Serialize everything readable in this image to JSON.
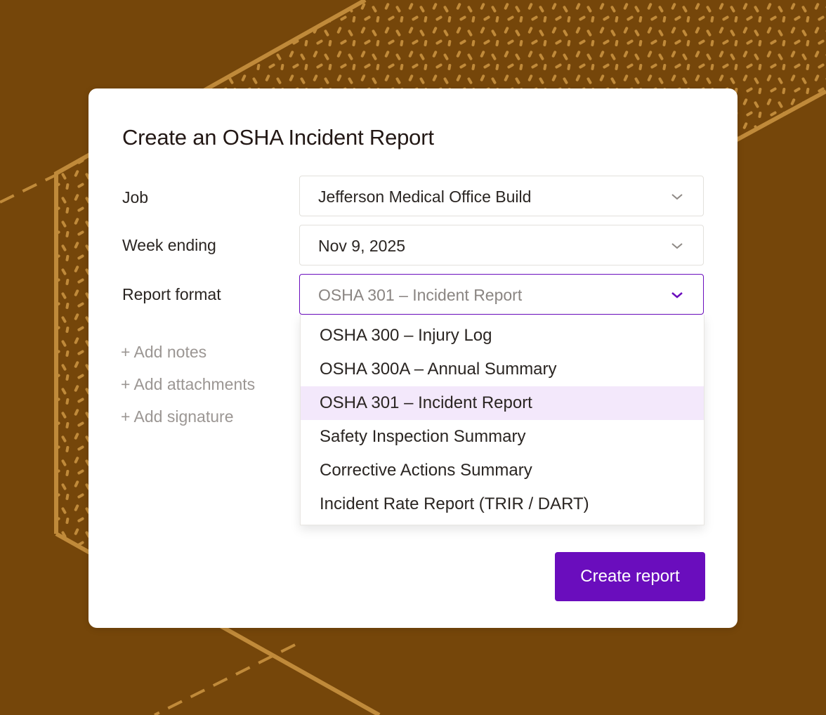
{
  "dialog": {
    "title": "Create an OSHA Incident Report"
  },
  "fields": {
    "job": {
      "label": "Job",
      "value": "Jefferson Medical Office Build"
    },
    "week_ending": {
      "label": "Week ending",
      "value": "Nov 9, 2025"
    },
    "report_format": {
      "label": "Report format",
      "value": "OSHA 301 – Incident Report"
    }
  },
  "add_links": [
    "+ Add notes",
    "+ Add attachments",
    "+ Add signature"
  ],
  "dropdown": {
    "options": [
      "OSHA 300 – Injury Log",
      "OSHA 300A – Annual Summary",
      "OSHA 301 – Incident Report",
      "Safety Inspection Summary",
      "Corrective Actions Summary",
      "Incident Rate Report (TRIR / DART)"
    ],
    "selected_index": 2
  },
  "actions": {
    "create_label": "Create report"
  },
  "colors": {
    "background": "#75460a",
    "pattern": "#c08a3a",
    "accent": "#6a0dbd",
    "selected_option_bg": "#f3e8fb"
  },
  "icons": {
    "select_arrow": "chevron-down-icon"
  }
}
